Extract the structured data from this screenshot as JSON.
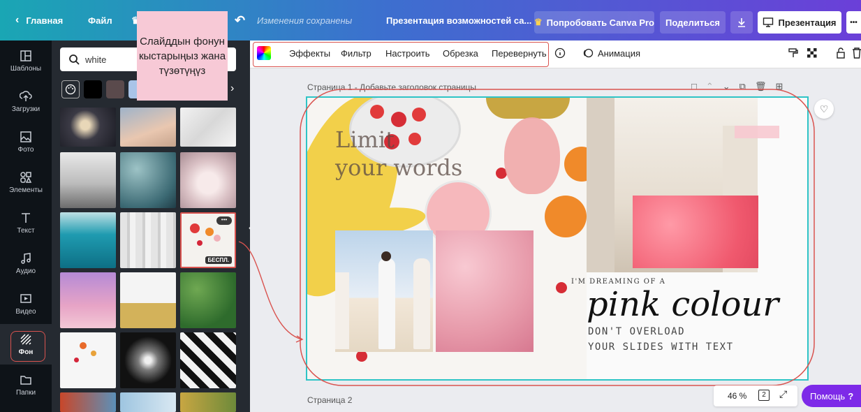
{
  "topbar": {
    "home_label": "Главная",
    "file_label": "Файл",
    "status_text": "Изменения сохранены",
    "doc_title": "Презентация возможностей са...",
    "try_pro_label": "Попробовать Canva Pro",
    "share_label": "Поделиться",
    "present_label": "Презентация",
    "more_label": "•••"
  },
  "sidebar": {
    "items": [
      {
        "label": "Шаблоны",
        "icon": "templates-icon"
      },
      {
        "label": "Загрузки",
        "icon": "upload-icon"
      },
      {
        "label": "Фото",
        "icon": "photo-icon"
      },
      {
        "label": "Элементы",
        "icon": "elements-icon"
      },
      {
        "label": "Текст",
        "icon": "text-icon"
      },
      {
        "label": "Аудио",
        "icon": "audio-icon"
      },
      {
        "label": "Видео",
        "icon": "video-icon"
      },
      {
        "label": "Фон",
        "icon": "background-icon"
      },
      {
        "label": "Папки",
        "icon": "folder-icon"
      }
    ]
  },
  "panel": {
    "search_value": "white",
    "free_badge": "БЕСПЛ.",
    "swatch_colors": [
      "#000000",
      "#5a4a4c",
      "#a9c4e8"
    ]
  },
  "note": {
    "text": "Слайддын фонун кыстарыңыз жана түзөтүңүз"
  },
  "toolbar": {
    "effects": "Эффекты",
    "filter": "Фильтр",
    "adjust": "Настроить",
    "crop": "Обрезка",
    "flip": "Перевернуть",
    "animation": "Анимация"
  },
  "canvas": {
    "page1_label": "Страница 1 - Добавьте заголовок страницы",
    "page2_label": "Страница 2",
    "zoom": "46 %",
    "page_count": "2",
    "help_label": "Помощь",
    "help_mark": "?"
  },
  "slide": {
    "headline_1": "Limit",
    "headline_2": "your words",
    "dreaming": "I'M DREAMING OF A",
    "pink_colour": "pink colour",
    "line1": "DON'T OVERLOAD",
    "line2": "YOUR SLIDES WITH TEXT"
  },
  "colors": {
    "accent_teal": "#2ec4c6",
    "annotation_red": "#d9534f",
    "help_purple": "#7d2ae8",
    "note_pink": "#f7c9d6"
  }
}
